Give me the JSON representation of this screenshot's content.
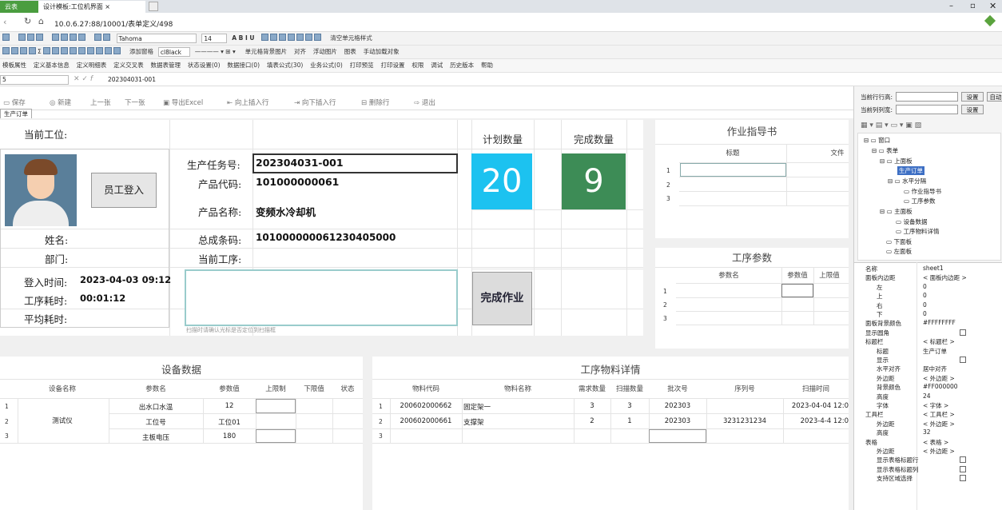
{
  "browser": {
    "tab1": "云表",
    "tab2": "设计模板:工位机界面",
    "url": "10.0.6.27:88/10001/表单定义/498"
  },
  "toolbar1": {
    "font": "Tahoma",
    "size": "14",
    "merge": "清空单元格样式"
  },
  "toolbar2": {
    "items": [
      "添加窗格",
      "cl8lack",
      "单元格背景图片",
      "对齐",
      "浮动图片",
      "图表",
      "手动加载对象"
    ]
  },
  "toolbar3": {
    "items": [
      "模板属性",
      "定义基本信息",
      "定义明细表",
      "定义交叉表",
      "数据表管理",
      "状态设置(0)",
      "数据接口(0)",
      "填表公式(30)",
      "业务公式(0)",
      "打印预览",
      "打印设置",
      "权限",
      "调试",
      "历史版本",
      "帮助"
    ]
  },
  "formula": {
    "cell": "5",
    "value": "202304031-001"
  },
  "actions": {
    "save": "保存",
    "new": "新建",
    "prev": "上一张",
    "next": "下一张",
    "export": "导出Excel",
    "insert_up": "向上插入行",
    "insert_down": "向下插入行",
    "delete_row": "删除行",
    "exit": "退出"
  },
  "sheet_tab": "生产订单",
  "form": {
    "current_station": "当前工位:",
    "name": "姓名:",
    "dept": "部门:",
    "login_time_label": "登入时间:",
    "login_time": "2023-04-03 09:12",
    "proc_time_label": "工序耗时:",
    "proc_time": "00:01:12",
    "avg_time_label": "平均耗时:",
    "employee_login": "员工登入",
    "task_label": "生产任务号:",
    "task": "202304031-001",
    "product_code_label": "产品代码:",
    "product_code": "101000000061",
    "product_name_label": "产品名称:",
    "product_name": "变频水冷却机",
    "barcode_label": "总成条码:",
    "barcode": "101000000061230405000",
    "current_proc_label": "当前工序:",
    "scan_hint": "扫描时请确认光标是否定位到扫描框",
    "plan_label": "计划数量",
    "plan": "20",
    "done_label": "完成数量",
    "done": "9",
    "finish_btn": "完成作业"
  },
  "guide": {
    "title": "作业指导书",
    "cols": [
      "标题",
      "文件"
    ],
    "rows": [
      "1",
      "2",
      "3"
    ]
  },
  "params": {
    "title": "工序参数",
    "cols": [
      "参数名",
      "参数值",
      "上限值"
    ],
    "rows": [
      "1",
      "2",
      "3"
    ]
  },
  "equipment": {
    "title": "设备数据",
    "cols": [
      "设备名称",
      "参数名",
      "参数值",
      "上限制",
      "下限值",
      "状态"
    ],
    "device": "测试仪",
    "rows": [
      {
        "n": "1",
        "param": "出水口水温",
        "value": "12"
      },
      {
        "n": "2",
        "param": "工位号",
        "value": "工位01"
      },
      {
        "n": "3",
        "param": "主板电压",
        "value": "180"
      }
    ]
  },
  "materials": {
    "title": "工序物料详情",
    "cols": [
      "物料代码",
      "物料名称",
      "需求数量",
      "扫描数量",
      "批次号",
      "序列号",
      "扫描时间"
    ],
    "rows": [
      {
        "n": "1",
        "code": "200602000662",
        "name": "固定架一",
        "need": "3",
        "scan": "3",
        "batch": "202303",
        "serial": "",
        "time": "2023-04-04 12:0"
      },
      {
        "n": "2",
        "code": "200602000661",
        "name": "支撑架",
        "need": "2",
        "scan": "1",
        "batch": "202303",
        "serial": "3231231234",
        "time": "2023-4-4 12:0"
      },
      {
        "n": "3",
        "code": "",
        "name": "",
        "need": "",
        "scan": "",
        "batch": "",
        "serial": "",
        "time": ""
      }
    ]
  },
  "right": {
    "row_label": "当前行行高:",
    "col_label": "当前列列宽:",
    "set": "设置",
    "auto": "自动",
    "tree": [
      "窗口",
      "表单",
      "上面板",
      "生产订单",
      "水平分隔",
      "作业指导书",
      "工序参数",
      "主面板",
      "设备数据",
      "工序物料详情",
      "下面板",
      "左面板"
    ],
    "props": [
      [
        "名称",
        "sheet1"
      ],
      [
        "面板内边距",
        "< 面板内边距 >"
      ],
      [
        "左",
        "0"
      ],
      [
        "上",
        "0"
      ],
      [
        "右",
        "0"
      ],
      [
        "下",
        "0"
      ],
      [
        "面板背景颜色",
        "#FFFFFFFF"
      ],
      [
        "显示圆角",
        ""
      ],
      [
        "标题栏",
        "< 标题栏 >"
      ],
      [
        "标题",
        "生产订单"
      ],
      [
        "显示",
        ""
      ],
      [
        "水平对齐",
        "居中对齐"
      ],
      [
        "外边距",
        "< 外边距 >"
      ],
      [
        "背景颜色",
        "#FF000000"
      ],
      [
        "高度",
        "24"
      ],
      [
        "字体",
        "< 字体 >"
      ],
      [
        "工具栏",
        "< 工具栏 >"
      ],
      [
        "外边距",
        "< 外边距 >"
      ],
      [
        "高度",
        "32"
      ],
      [
        "表格",
        "< 表格 >"
      ],
      [
        "外边距",
        "< 外边距 >"
      ],
      [
        "显示表格标题行",
        ""
      ],
      [
        "显示表格标题列",
        ""
      ],
      [
        "支持区域选择",
        ""
      ]
    ]
  }
}
